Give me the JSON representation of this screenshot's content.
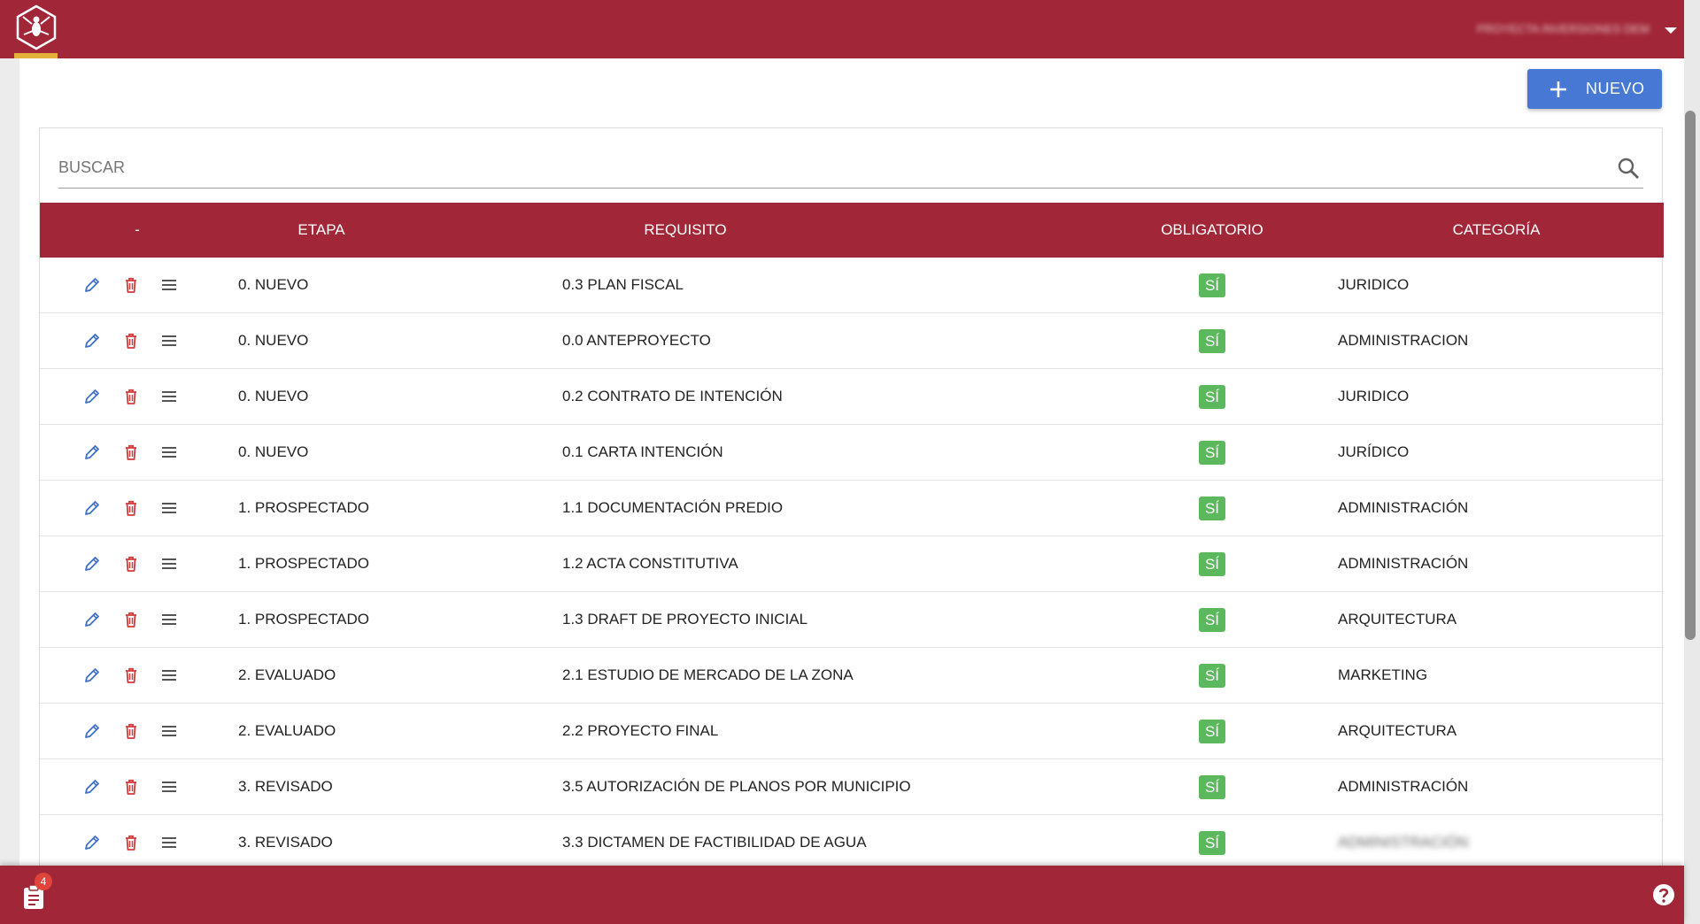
{
  "header": {
    "user_name": "PROYECTA INVERSIONES DEMO"
  },
  "toolbar": {
    "new_label": "NUEVO"
  },
  "search": {
    "placeholder": "BUSCAR"
  },
  "table": {
    "columns": {
      "actions": "-",
      "etapa": "ETAPA",
      "requisito": "REQUISITO",
      "obligatorio": "OBLIGATORIO",
      "categoria": "CATEGORÍA"
    },
    "rows": [
      {
        "etapa": "0. NUEVO",
        "requisito": "0.3 PLAN FISCAL",
        "obligatorio": "SÍ",
        "categoria": "JURIDICO"
      },
      {
        "etapa": "0. NUEVO",
        "requisito": "0.0 ANTEPROYECTO",
        "obligatorio": "SÍ",
        "categoria": "ADMINISTRACION"
      },
      {
        "etapa": "0. NUEVO",
        "requisito": "0.2 CONTRATO DE INTENCIÓN",
        "obligatorio": "SÍ",
        "categoria": "JURIDICO"
      },
      {
        "etapa": "0. NUEVO",
        "requisito": "0.1 CARTA INTENCIÓN",
        "obligatorio": "SÍ",
        "categoria": "JURÍDICO"
      },
      {
        "etapa": "1. PROSPECTADO",
        "requisito": "1.1 DOCUMENTACIÓN PREDIO",
        "obligatorio": "SÍ",
        "categoria": "ADMINISTRACIÓN"
      },
      {
        "etapa": "1. PROSPECTADO",
        "requisito": "1.2 ACTA CONSTITUTIVA",
        "obligatorio": "SÍ",
        "categoria": "ADMINISTRACIÓN"
      },
      {
        "etapa": "1. PROSPECTADO",
        "requisito": "1.3 DRAFT DE PROYECTO INICIAL",
        "obligatorio": "SÍ",
        "categoria": "ARQUITECTURA"
      },
      {
        "etapa": "2. EVALUADO",
        "requisito": "2.1 ESTUDIO DE MERCADO DE LA ZONA",
        "obligatorio": "SÍ",
        "categoria": "MARKETING"
      },
      {
        "etapa": "2. EVALUADO",
        "requisito": "2.2 PROYECTO FINAL",
        "obligatorio": "SÍ",
        "categoria": "ARQUITECTURA"
      },
      {
        "etapa": "3. REVISADO",
        "requisito": "3.5 AUTORIZACIÓN DE PLANOS POR MUNICIPIO",
        "obligatorio": "SÍ",
        "categoria": "ADMINISTRACIÓN"
      },
      {
        "etapa": "3. REVISADO",
        "requisito": "3.3 DICTAMEN DE FACTIBILIDAD DE AGUA",
        "obligatorio": "SÍ",
        "categoria": "ADMINISTRACIÓN",
        "categoria_blurred": true
      }
    ]
  },
  "footer": {
    "notifications_count": "4"
  },
  "icons": {
    "logo": "hexagon-bee-logo-icon",
    "new": "plus-icon",
    "search": "search-icon",
    "edit": "pencil-icon",
    "delete": "trash-icon",
    "drag": "menu-lines-icon",
    "tasks": "clipboard-icon",
    "help": "help-circle-icon"
  },
  "colors": {
    "brand": "#a12637",
    "accent": "#e4b23b",
    "primary_button": "#4678d4",
    "edit_icon": "#3f6fc6",
    "delete_icon": "#d23a3a",
    "badge_success": "#5cb85c"
  }
}
